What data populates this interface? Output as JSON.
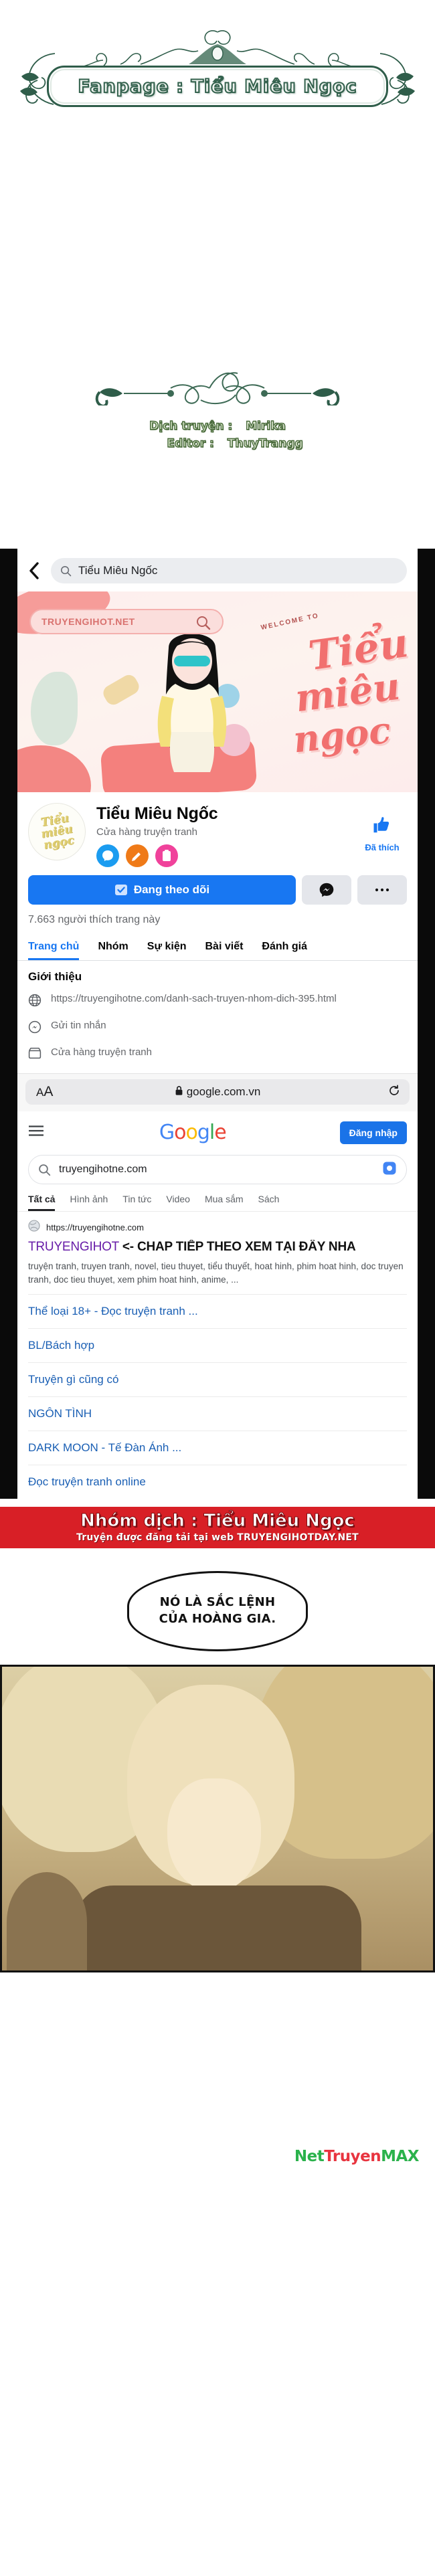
{
  "fanpage_banner": {
    "label": "Fanpage : Tiểu Miêu Ngọc",
    "frame_color": "#2f5d4a"
  },
  "credits": {
    "translator_label": "Dịch truyện :",
    "translator_name": "Mirika",
    "editor_label": "Editor :",
    "editor_name": "ThuyTrangg"
  },
  "facebook": {
    "search": {
      "back_icon": "chevron-left-icon",
      "search_icon": "search-icon",
      "query": "Tiểu Miêu Ngốc"
    },
    "cover": {
      "site_pill": "TRUYENGIHOT.NET",
      "search_icon": "magnifier-icon",
      "welcome_text": "WELCOME TO",
      "brush_line_1": "Tiểu",
      "brush_line_2": "miêu",
      "brush_line_3": "ngọc"
    },
    "page": {
      "avatar_text": "Tiểu miêu ngọc",
      "name": "Tiểu Miêu Ngốc",
      "category": "Cửa hàng truyện tranh",
      "badges": [
        "messenger-badge-icon",
        "pen-badge-icon",
        "clipboard-badge-icon"
      ],
      "like_icon": "thumbs-up-icon",
      "like_label": "Đã thích"
    },
    "actions": {
      "follow_icon": "following-check-icon",
      "follow_label": "Đang theo dõi",
      "message_icon": "messenger-icon",
      "more_icon": "ellipsis-icon"
    },
    "likes_line": "7.663 người thích trang này",
    "tabs": [
      {
        "label": "Trang chủ",
        "active": true
      },
      {
        "label": "Nhóm",
        "active": false
      },
      {
        "label": "Sự kiện",
        "active": false
      },
      {
        "label": "Bài viết",
        "active": false
      },
      {
        "label": "Đánh giá",
        "active": false
      }
    ],
    "intro": {
      "heading": "Giới thiệu",
      "rows": [
        {
          "icon": "globe-icon",
          "text": "https://truyengihotne.com/danh-sach-truyen-nhom-dich-395.html"
        },
        {
          "icon": "messenger-outline-icon",
          "text": "Gửi tin nhắn"
        },
        {
          "icon": "store-icon",
          "text": "Cửa hàng truyện tranh"
        }
      ]
    }
  },
  "safari": {
    "text_size_icon": "aa-icon",
    "lock_icon": "lock-icon",
    "host": "google.com.vn",
    "reload_icon": "reload-icon"
  },
  "google": {
    "menu_icon": "hamburger-icon",
    "logo_letters": [
      "G",
      "o",
      "o",
      "g",
      "l",
      "e"
    ],
    "signin_label": "Đăng nhập",
    "search": {
      "icon": "search-icon",
      "value": "truyengihotne.com",
      "lens_icon": "lens-icon"
    },
    "tabs": [
      {
        "label": "Tất cả",
        "active": true
      },
      {
        "label": "Hình ảnh",
        "active": false
      },
      {
        "label": "Tin tức",
        "active": false
      },
      {
        "label": "Video",
        "active": false
      },
      {
        "label": "Mua sắm",
        "active": false
      },
      {
        "label": "Sách",
        "active": false
      }
    ],
    "result": {
      "favicon": "globe-favicon-icon",
      "url": "https://truyengihotne.com",
      "title_brand": "TRUYENGIHOT",
      "title_rest": "<- CHAP TIẾP THEO XEM TẠI ĐÂY NHA",
      "description": "truyện tranh, truyen tranh, novel, tieu thuyet, tiểu thuyết, hoat hinh, phim hoat hinh, doc truyen tranh, doc tieu thuyet, xem phim hoat hinh, anime, ..."
    },
    "sitelinks": [
      "Thể loại 18+ - Đọc truyện tranh ...",
      "BL/Bách hợp",
      "Truyện gì cũng có",
      "NGÔN TÌNH",
      "DARK MOON - Tế Đàn Ánh ...",
      "Đọc truyện tranh online"
    ]
  },
  "group_banner": {
    "title": "Nhóm dịch : Tiểu Miêu Ngọc",
    "subtitle": "Truyện được đăng tải tại web TRUYENGIHOTDAY.NET",
    "bg_color": "#d81f26"
  },
  "comic": {
    "speech_bubble": "NÓ LÀ SẮC LỆNH CỦA HOÀNG GIA."
  },
  "footer": {
    "watermark_part1": "Net",
    "watermark_part2": "Truyen",
    "watermark_part3": "MAX"
  }
}
